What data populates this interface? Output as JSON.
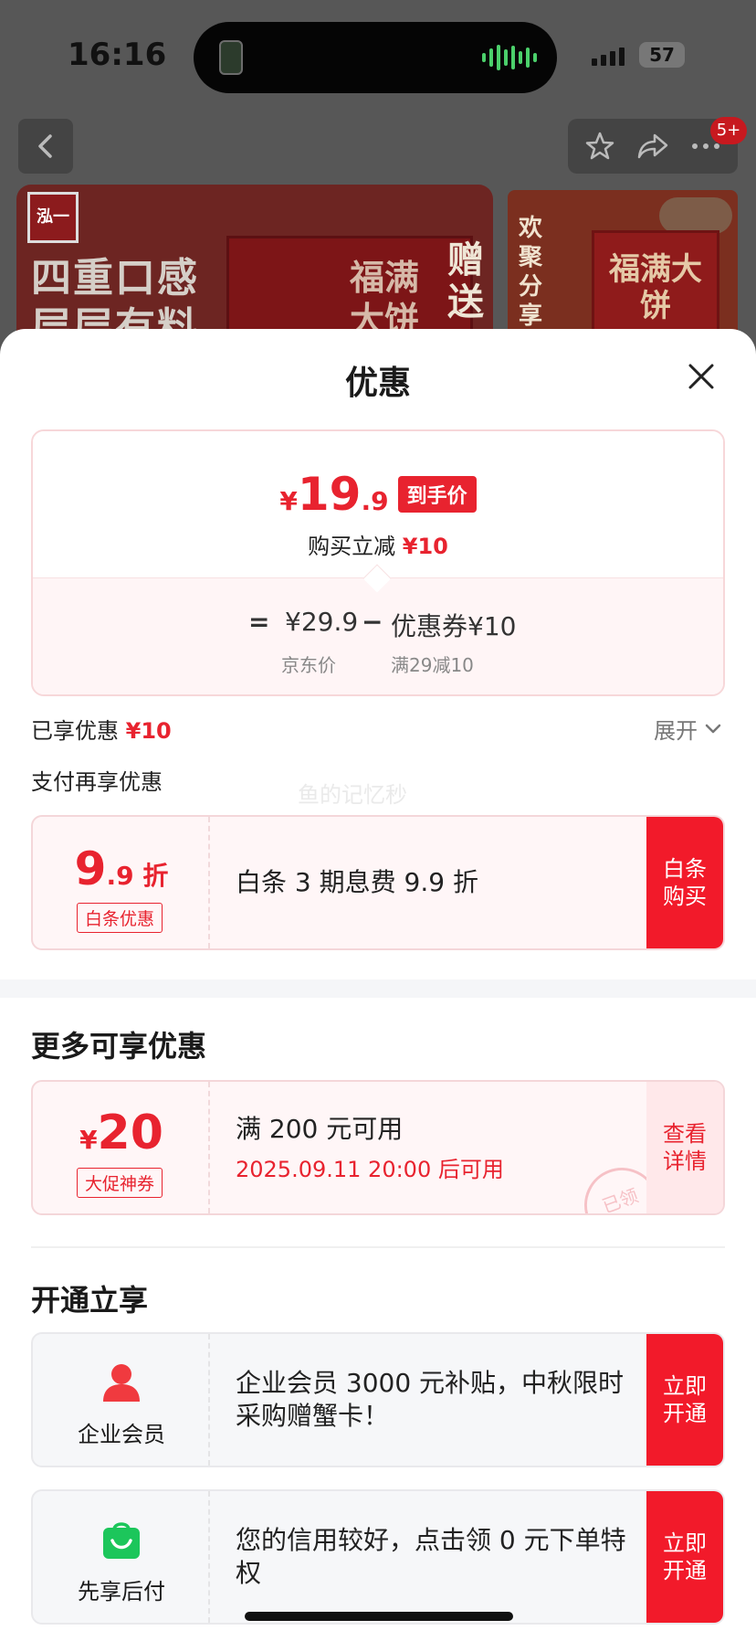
{
  "status": {
    "time": "16:16",
    "battery": "57"
  },
  "nav": {
    "badge": "5+"
  },
  "banner": {
    "logo": "泓一",
    "headline_1": "四重口感",
    "headline_2": "层层有料",
    "box_text": "福满大饼",
    "gift": "赠送",
    "side_text": "欢聚分享更",
    "side_box": "福满大饼"
  },
  "sheet": {
    "title": "优惠"
  },
  "price": {
    "currency": "¥",
    "int": "19",
    "dec": ".9",
    "tag": "到手价",
    "sub_label": "购买立减",
    "sub_value": "¥10",
    "equals": "=",
    "jd_price": "¥29.9",
    "minus": "−",
    "coupon": "优惠券¥10",
    "jd_price_label": "京东价",
    "coupon_label": "满29减10"
  },
  "enjoyed": {
    "label": "已享优惠",
    "value": "¥10",
    "expand": "展开"
  },
  "pay_more": {
    "title": "支付再享优惠",
    "watermark": "鱼的记忆秒"
  },
  "baitiao": {
    "big": "9",
    "small": ".9 折",
    "chip": "白条优惠",
    "title": "白条 3 期息费 9.9 折",
    "action": "白条购买"
  },
  "more": {
    "title": "更多可享优惠",
    "coupon": {
      "currency": "¥",
      "value": "20",
      "chip": "大促神券",
      "title": "满 200 元可用",
      "sub": "2025.09.11 20:00 后可用",
      "action": "查看详情",
      "stamp": "已领"
    }
  },
  "open": {
    "title": "开通立享",
    "items": [
      {
        "icon": "user-icon",
        "label": "企业会员",
        "title": "企业会员 3000 元补贴，中秋限时采购赠蟹卡！",
        "action": "立即开通"
      },
      {
        "icon": "shopping-bag-icon",
        "label": "先享后付",
        "title": "您的信用较好，点击领 0 元下单特权",
        "action": "立即开通"
      }
    ]
  },
  "colors": {
    "accent": "#e8232f",
    "action": "#f21a2a",
    "card_pink": "#fff6f7",
    "section_bg": "#f5f6f8"
  }
}
